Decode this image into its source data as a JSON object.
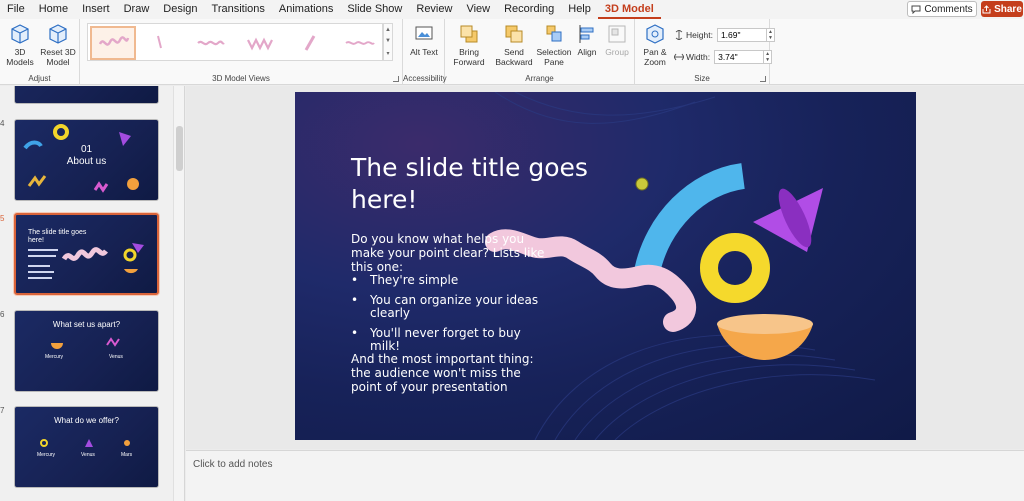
{
  "menu": {
    "items": [
      "File",
      "Home",
      "Insert",
      "Draw",
      "Design",
      "Transitions",
      "Animations",
      "Slide Show",
      "Review",
      "View",
      "Recording",
      "Help",
      "3D Model"
    ],
    "active": "3D Model",
    "comments_label": "Comments",
    "share_label": "Share"
  },
  "ribbon": {
    "adjust": {
      "model_btn": "3D Models",
      "reset_btn": "Reset 3D Model",
      "label": "Adjust"
    },
    "views": {
      "label": "3D Model Views"
    },
    "accessibility": {
      "alt_text": "Alt Text",
      "label": "Accessibility"
    },
    "arrange": {
      "bring_forward": "Bring Forward",
      "send_backward": "Send Backward",
      "selection_pane": "Selection Pane",
      "align": "Align",
      "group": "Group",
      "label": "Arrange"
    },
    "size": {
      "pan_zoom": "Pan & Zoom",
      "height_label": "Height:",
      "height_value": "1.69\"",
      "width_label": "Width:",
      "width_value": "3.74\"",
      "label": "Size"
    }
  },
  "thumbnails": [
    {
      "num": "4",
      "line1": "01",
      "line2": "About us"
    },
    {
      "num": "5",
      "line1": "The slide title goes here!",
      "selected": true
    },
    {
      "num": "6",
      "line1": "What set us apart?",
      "col1": "Mercury",
      "col2": "Venus"
    },
    {
      "num": "7",
      "line1": "What do we offer?",
      "col1": "Mercury",
      "col2": "Venus",
      "col3": "Mars"
    }
  ],
  "slide": {
    "title": "The slide title goes here!",
    "intro": "Do you know what helps you make your point clear? Lists like this one:",
    "bullets": [
      "They're simple",
      "You can organize your ideas clearly",
      "You'll never forget to buy milk!"
    ],
    "closing": "And the most important thing: the audience won't miss the point of your presentation"
  },
  "notes": {
    "placeholder": "Click to add notes"
  },
  "colors": {
    "accent": "#c43e1c",
    "slide_bg": "#172259"
  }
}
